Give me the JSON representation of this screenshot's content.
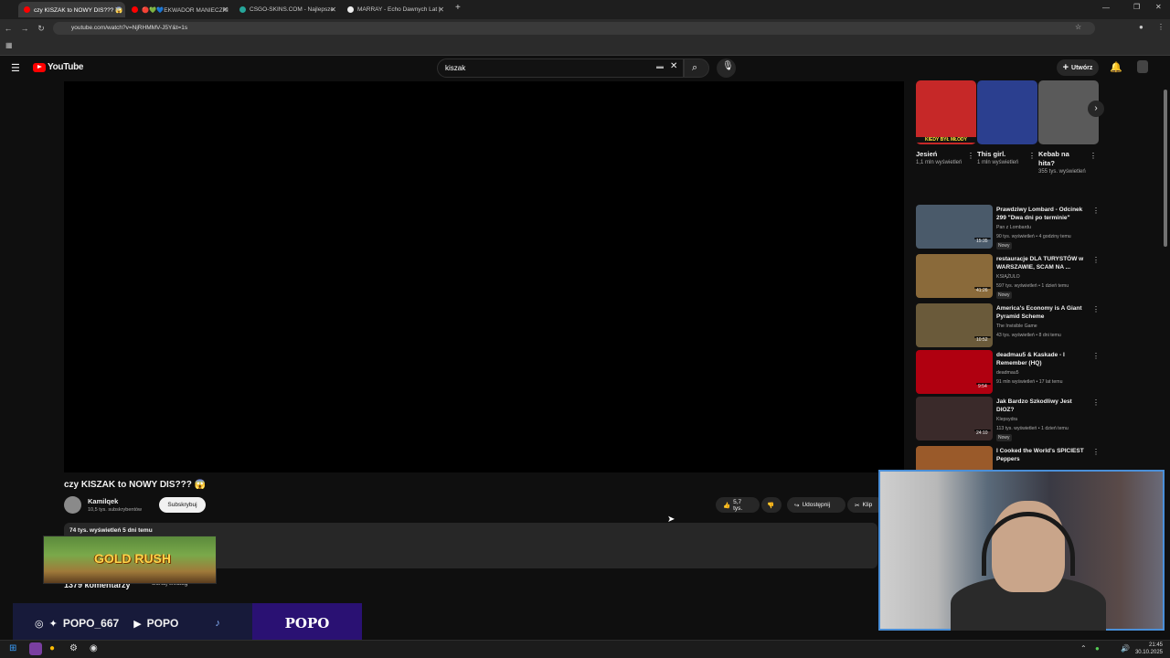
{
  "browser": {
    "tabs": [
      {
        "label": "czy KISZAK to NOWY DIS??? 😱",
        "active": true
      },
      {
        "label": "🔴💚💙EKWADOR MANIECZKI",
        "active": false
      },
      {
        "label": "CSGO-SKINS.COM - Najlepsze",
        "active": false
      },
      {
        "label": "MARRAY - Echo Dawnych Lat |",
        "active": false
      }
    ],
    "url": "youtube.com/watch?v=NjRHMMV-J5Y&t=1s"
  },
  "youtube": {
    "logo_text": "YouTube",
    "search_value": "kiszak",
    "create_label": "Utwórz"
  },
  "video": {
    "title": "czy KISZAK to NOWY DIS??? 😱",
    "channel_name": "Kamilqek",
    "channel_subs": "10,5 tys. subskrybentów",
    "subscribe_label": "Subskrybuj",
    "likes": "5,7 tys.",
    "share_label": "Udostępnij",
    "clip_label": "Klip",
    "meta": "74 tys. wyświetleń  5 dni temu",
    "comments_count": "1379 komentarzy",
    "sort_label": "Sortuj według"
  },
  "shorts": [
    {
      "title": "Jesień",
      "meta": "1,1 mln wyświetleń",
      "thumb_caption": "KIEDY BYŁ MŁODY",
      "color": "#c62828"
    },
    {
      "title": "This girl.",
      "meta": "1 mln wyświetleń",
      "color": "#2b3f8f"
    },
    {
      "title": "Kebab na hita?",
      "meta": "355 tys. wyświetleń",
      "color": "#5a5a5a"
    }
  ],
  "suggestions": [
    {
      "title": "Prawdziwy Lombard - Odcinek 299 \"Dwa dni po terminie\"",
      "channel": "Pan z Lombardu",
      "meta": "90 tys. wyświetleń • 4 godziny temu",
      "badge": "Nowy",
      "duration": "15:35",
      "color": "#4a5a6a"
    },
    {
      "title": "restauracje DLA TURYSTÓW w WARSZAWIE, SCAM NA ...",
      "channel": "KSIĄŻULO",
      "meta": "597 tys. wyświetleń • 1 dzień temu",
      "badge": "Nowy",
      "duration": "41:26",
      "color": "#8a6a3a"
    },
    {
      "title": "America's Economy is A Giant Pyramid Scheme",
      "channel": "The Invisible Game",
      "meta": "43 tys. wyświetleń • 8 dni temu",
      "badge": "",
      "duration": "10:52",
      "color": "#6a5a3a"
    },
    {
      "title": "deadmau5 & Kaskade - I Remember (HQ)",
      "channel": "deadmau5",
      "meta": "91 mln wyświetleń • 17 lat temu",
      "badge": "",
      "duration": "9:54",
      "color": "#b00010"
    },
    {
      "title": "Jak Bardzo Szkodliwy Jest DIOZ?",
      "channel": "Klepsydra",
      "meta": "113 tys. wyświetleń • 1 dzień temu",
      "badge": "Nowy",
      "duration": "24:10",
      "color": "#3a2a2a"
    },
    {
      "title": "I Cooked the World's SPICIEST Peppers",
      "channel": "",
      "meta": "",
      "badge": "",
      "duration": "",
      "color": "#9a5a2a"
    }
  ],
  "overlay": {
    "banner_text": "GOLD RUSH",
    "social_handle": "POPO_667",
    "yt_handle": "POPO",
    "brand": "POPO"
  },
  "taskbar": {
    "time": "21:45",
    "date": "30.10.2025"
  }
}
